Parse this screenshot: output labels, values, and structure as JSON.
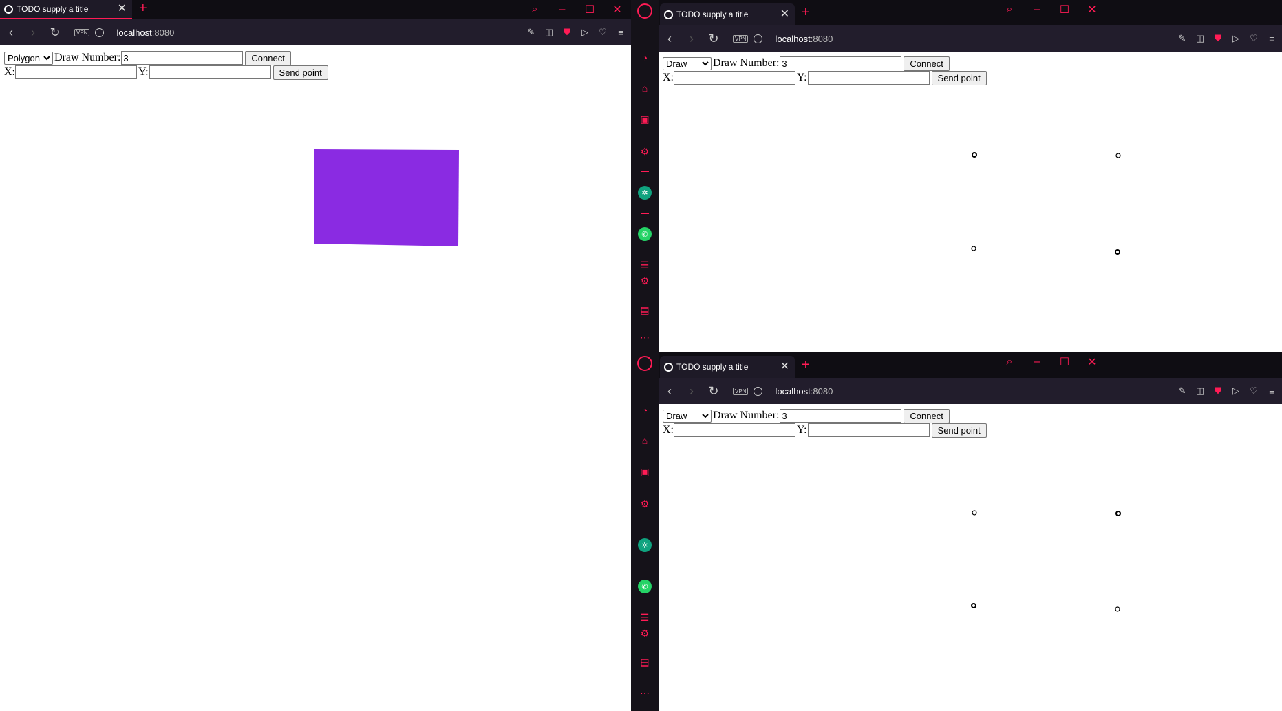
{
  "tab_title": "TODO supply a title",
  "url_host": "localhost",
  "url_port": ":8080",
  "vpn_label": "VPN",
  "form": {
    "draw_number_label": "Draw Number:",
    "draw_number_value": "3",
    "connect_label": "Connect",
    "x_label": "X:",
    "y_label": "Y:",
    "send_point_label": "Send point"
  },
  "left_window": {
    "mode": "Polygon",
    "polygon_color": "#8a2be2"
  },
  "right_windows": {
    "mode": "Draw"
  },
  "accent_color": "#ff1b55",
  "icons": [
    "globe-icon",
    "close-icon",
    "plus-icon",
    "search-icon",
    "minimize-icon",
    "maximize-icon",
    "back-icon",
    "forward-icon",
    "reload-icon",
    "camera-icon",
    "shield-icon",
    "send-icon",
    "heart-icon",
    "menu-icon",
    "opera-icon",
    "speed-dial-icon",
    "chatgpt-icon",
    "whatsapp-icon",
    "twitch-icon",
    "more-icon"
  ]
}
